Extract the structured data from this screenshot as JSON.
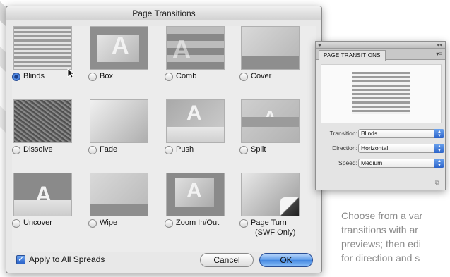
{
  "dialog": {
    "title": "Page Transitions",
    "transitions": [
      {
        "label": "Blinds",
        "icon": "blinds-thumb",
        "selected": true
      },
      {
        "label": "Box",
        "icon": "box-thumb",
        "selected": false
      },
      {
        "label": "Comb",
        "icon": "comb-thumb",
        "selected": false
      },
      {
        "label": "Cover",
        "icon": "cover-thumb",
        "selected": false
      },
      {
        "label": "Dissolve",
        "icon": "dissolve-thumb",
        "selected": false
      },
      {
        "label": "Fade",
        "icon": "fade-thumb",
        "selected": false
      },
      {
        "label": "Push",
        "icon": "push-thumb",
        "selected": false
      },
      {
        "label": "Split",
        "icon": "split-thumb",
        "selected": false
      },
      {
        "label": "Uncover",
        "icon": "uncover-thumb",
        "selected": false
      },
      {
        "label": "Wipe",
        "icon": "wipe-thumb",
        "selected": false
      },
      {
        "label": "Zoom In/Out",
        "icon": "zoom-thumb",
        "selected": false
      },
      {
        "label": "Page Turn",
        "label_line2": "(SWF Only)",
        "icon": "page-turn-thumb",
        "selected": false
      }
    ],
    "apply_all_label": "Apply to All Spreads",
    "apply_all_checked": true,
    "cancel_label": "Cancel",
    "ok_label": "OK",
    "accent_color": "#2b63c9"
  },
  "panel": {
    "tab_label": "PAGE TRANSITIONS",
    "transition_label": "Transition:",
    "transition_value": "Blinds",
    "direction_label": "Direction:",
    "direction_value": "Horizontal",
    "speed_label": "Speed:",
    "speed_value": "Medium"
  },
  "caption": {
    "lines": [
      "Choose from a var",
      "transitions with ar",
      "previews; then edi",
      "for direction and s"
    ]
  }
}
